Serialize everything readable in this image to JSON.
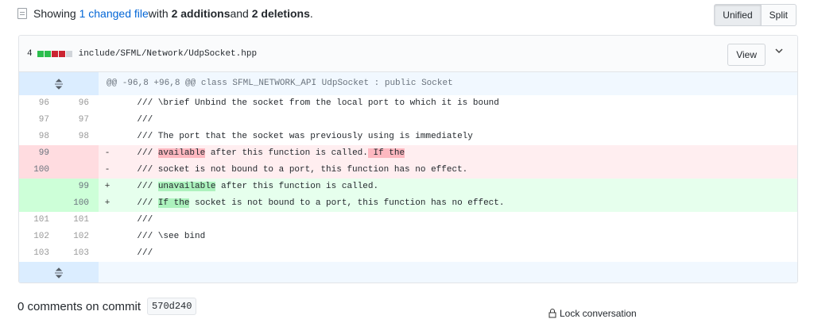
{
  "summary": {
    "prefix": "Showing ",
    "changed_link": "1 changed file",
    "middle": " with ",
    "additions": "2 additions",
    "and": " and ",
    "deletions": "2 deletions",
    "end": "."
  },
  "view_toggle": {
    "unified": "Unified",
    "split": "Split"
  },
  "file": {
    "change_count": "4",
    "path": "include/SFML/Network/UdpSocket.hpp",
    "view_label": "View"
  },
  "diff": {
    "hunk_header": "@@ -96,8 +96,8 @@ class SFML_NETWORK_API UdpSocket : public Socket",
    "lines": [
      {
        "old": "96",
        "new": "96",
        "marker": "",
        "code": "    /// \\brief Unbind the socket from the local port to which it is bound"
      },
      {
        "old": "97",
        "new": "97",
        "marker": "",
        "code": "    ///"
      },
      {
        "old": "98",
        "new": "98",
        "marker": "",
        "code": "    /// The port that the socket was previously using is immediately"
      },
      {
        "old": "99",
        "new": "",
        "marker": "-",
        "code_prefix": "    /// ",
        "hl1": "available",
        "mid": " after this function is called.",
        "hl2": " If the",
        "rest": ""
      },
      {
        "old": "100",
        "new": "",
        "marker": "-",
        "code": "    /// socket is not bound to a port, this function has no effect."
      },
      {
        "old": "",
        "new": "99",
        "marker": "+",
        "code_prefix": "    /// ",
        "hl1": "unavailable",
        "rest": " after this function is called."
      },
      {
        "old": "",
        "new": "100",
        "marker": "+",
        "code_prefix": "    /// ",
        "hl1": "If the",
        "rest": " socket is not bound to a port, this function has no effect."
      },
      {
        "old": "101",
        "new": "101",
        "marker": "",
        "code": "    ///"
      },
      {
        "old": "102",
        "new": "102",
        "marker": "",
        "code": "    /// \\see bind"
      },
      {
        "old": "103",
        "new": "103",
        "marker": "",
        "code": "    ///"
      }
    ]
  },
  "comments": {
    "label": "0 comments on commit",
    "sha": "570d240"
  },
  "lock": {
    "label": "Lock conversation"
  }
}
